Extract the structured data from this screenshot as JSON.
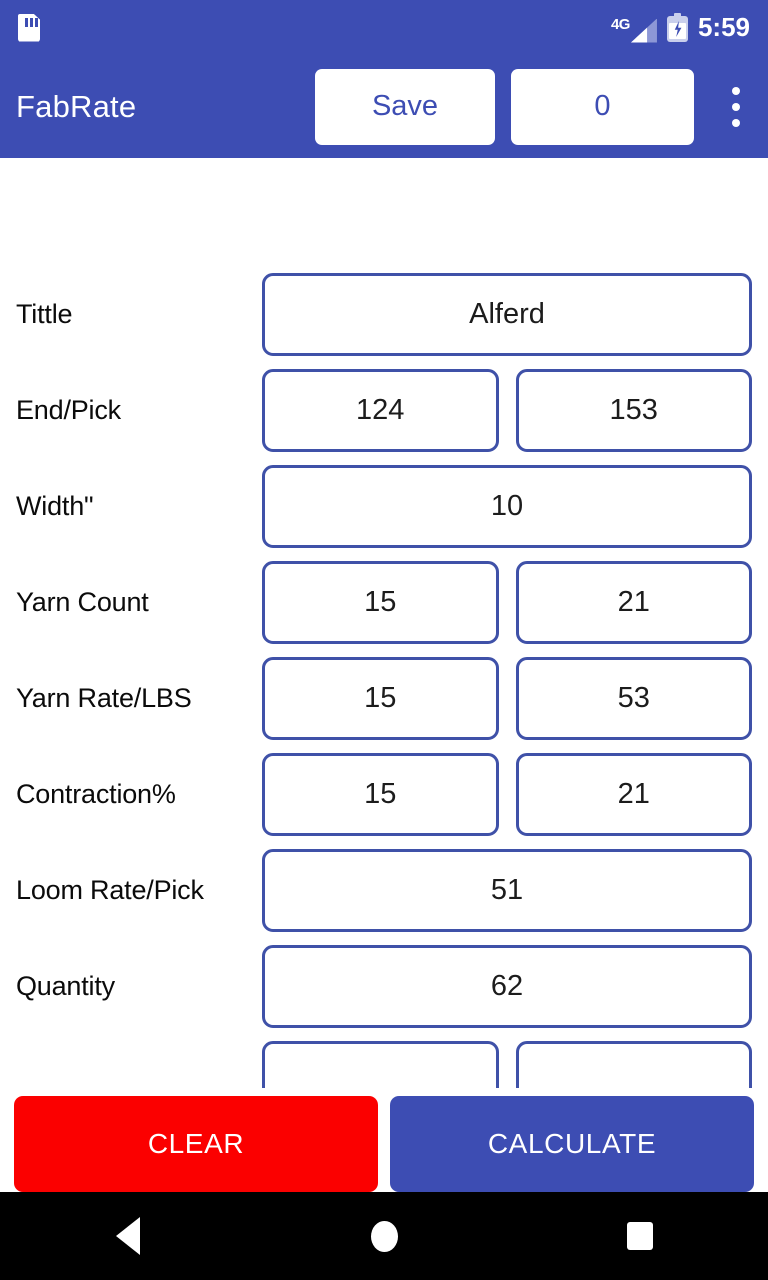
{
  "status_bar": {
    "sd_card_icon": "sd-card-icon",
    "network_label": "4G",
    "signal_icon": "signal-bars-icon",
    "battery_icon": "battery-charging-icon",
    "time": "5:59"
  },
  "app_bar": {
    "title": "FabRate",
    "save_label": "Save",
    "count_value": "0",
    "overflow_icon": "more-vertical-icon"
  },
  "form": {
    "rows": [
      {
        "label": "Tittle",
        "values": [
          "Alferd"
        ]
      },
      {
        "label": "End/Pick",
        "values": [
          "124",
          "153"
        ]
      },
      {
        "label": "Width\"",
        "values": [
          "10"
        ]
      },
      {
        "label": "Yarn Count",
        "values": [
          "15",
          "21"
        ]
      },
      {
        "label": "Yarn Rate/LBS",
        "values": [
          "15",
          "53"
        ]
      },
      {
        "label": "Contraction%",
        "values": [
          "15",
          "21"
        ]
      },
      {
        "label": "Loom Rate/Pick",
        "values": [
          "51"
        ]
      },
      {
        "label": "Quantity",
        "values": [
          "62"
        ]
      },
      {
        "label": "",
        "values": [
          "",
          ""
        ]
      }
    ]
  },
  "actions": {
    "clear_label": "CLEAR",
    "calculate_label": "CALCULATE"
  },
  "nav_bar": {
    "back_icon": "back-triangle-icon",
    "home_icon": "home-circle-icon",
    "recent_icon": "recent-square-icon"
  },
  "colors": {
    "primary": "#3d4db3",
    "field_border": "#3f51a8",
    "clear": "#fb0000",
    "background": "#ffffff"
  }
}
